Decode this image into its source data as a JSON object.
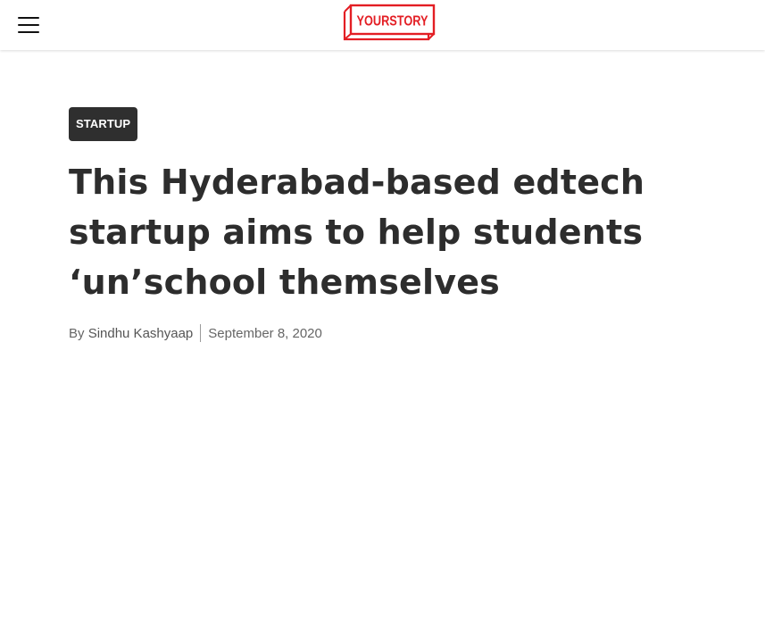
{
  "header": {
    "menu_icon": "hamburger-menu-icon",
    "logo_text": "YOURSTORY",
    "logo_color": "#e31e24"
  },
  "article": {
    "category": "STARTUP",
    "title": "This Hyderabad-based edtech startup aims to help students ‘un’school themselves",
    "byline_prefix": "By ",
    "author": "Sindhu Kashyaap",
    "date": "September 8, 2020"
  },
  "colors": {
    "text_dark": "#2d2d2d",
    "badge_bg": "#2f2f2f",
    "meta_text": "#666666"
  }
}
